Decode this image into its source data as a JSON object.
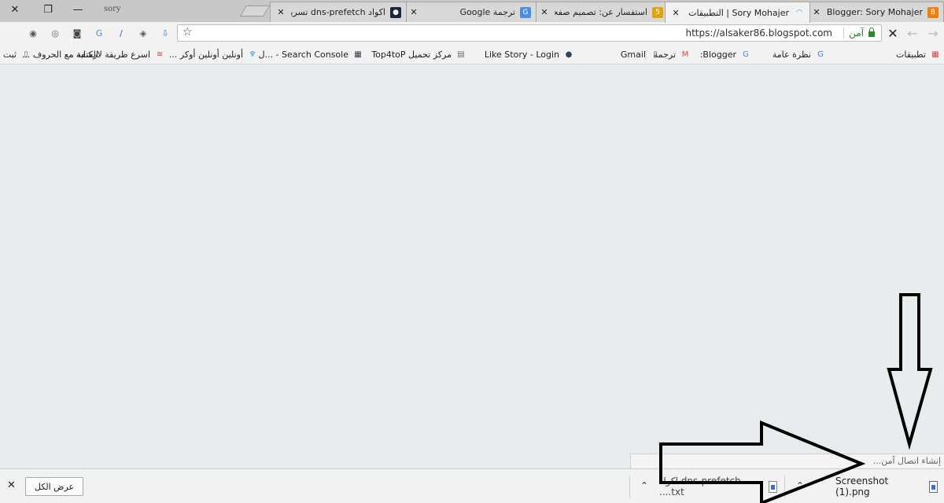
{
  "window": {
    "profile_name": "sory",
    "close_glyph": "✕",
    "restore_glyph": "❐",
    "minimize_glyph": "—"
  },
  "tabs": [
    {
      "title": "Blogger: Sory Mohajer -",
      "favicon": "blogger-icon",
      "favicon_text": "B",
      "favicon_color": "#f57d00",
      "active": false
    },
    {
      "title": "Sory Mohajer | التطبيقات",
      "favicon": "loading-spinner-icon",
      "favicon_text": "◠",
      "favicon_color": "#4a8fe0",
      "active": true
    },
    {
      "title": "استفسار عن: تصميم صفحة",
      "favicon": "forum-icon",
      "favicon_text": "5",
      "favicon_color": "#e2a400",
      "active": false
    },
    {
      "title": "ترجمة Google",
      "favicon": "google-translate-icon",
      "favicon_text": "G",
      "favicon_color": "#4a8fe0",
      "active": false
    },
    {
      "title": "اكواد dns-prefetch تسريع",
      "favicon": "site-icon",
      "favicon_text": "●",
      "favicon_color": "#1a2540",
      "active": false
    }
  ],
  "tab_close_glyph": "✕",
  "toolbar": {
    "url": "https://alsaker86.blogspot.com",
    "secure_label": "آمن",
    "close_glyph": "✕",
    "back_glyph": "←",
    "forward_glyph": "→",
    "reload_glyph": "↻",
    "star_glyph": "☆"
  },
  "extensions": [
    {
      "name": "extension-1-icon",
      "glyph": "◉",
      "color": "#555"
    },
    {
      "name": "extension-2-icon",
      "glyph": "◎",
      "color": "#666"
    },
    {
      "name": "extension-3-icon",
      "glyph": "◙",
      "color": "#444"
    },
    {
      "name": "translate-extension-icon",
      "glyph": "G",
      "color": "#4a8fe0"
    },
    {
      "name": "pen-extension-icon",
      "glyph": "∕",
      "color": "#7a3fc0"
    },
    {
      "name": "shield-extension-icon",
      "glyph": "◈",
      "color": "#555"
    },
    {
      "name": "download-extension-icon",
      "glyph": "⇩",
      "color": "#2f7fd0"
    }
  ],
  "bookmarks": [
    {
      "label": "تطبيقات",
      "icon": "apps-grid-icon",
      "glyph": "▦",
      "color": "#d44"
    },
    {
      "label": "نظرة عامة",
      "icon": "google-icon",
      "glyph": "G",
      "color": "#4285f4"
    },
    {
      "label": "Blogger:",
      "icon": "translate-icon",
      "glyph": "G",
      "color": "#4a8fe0"
    },
    {
      "label": "ترجمة",
      "icon": "gmail-icon",
      "glyph": "M",
      "color": "#d44"
    },
    {
      "label": "Gmail",
      "icon": "page-icon",
      "glyph": "▯",
      "color": "#666"
    },
    {
      "label": "Like Story - Login",
      "icon": "globe-icon",
      "glyph": "●",
      "color": "#345"
    },
    {
      "label": "مركز تحميل Top4toP",
      "icon": "store-icon",
      "glyph": "▤",
      "color": "#667"
    },
    {
      "label": "Search Console - ...ل",
      "icon": "grid-icon",
      "glyph": "▦",
      "color": "#334"
    },
    {
      "label": "أونلين أونلين أوكر ...",
      "icon": "bird-icon",
      "glyph": "♆",
      "color": "#2a9adc"
    },
    {
      "label": "اسرع طريقة لارشفة ...",
      "icon": "waves-icon",
      "glyph": "≋",
      "color": "#c44"
    },
    {
      "label": "الكتابة مع الحروف ...",
      "icon": "none",
      "glyph": "",
      "color": "#000"
    },
    {
      "label": "ثبت",
      "icon": "page-icon",
      "glyph": "▯",
      "color": "#666"
    }
  ],
  "status_text": "إنشاء اتصال آمن...",
  "downloads": [
    {
      "filename": "Screenshot (1).png",
      "icon": "image-file-icon"
    },
    {
      "filename": "اكواد dns-prefetch ....txt",
      "icon": "text-file-icon"
    }
  ],
  "download_chevron_glyph": "⌃",
  "show_all_label": "عرض الكل",
  "shelf_close_glyph": "✕"
}
